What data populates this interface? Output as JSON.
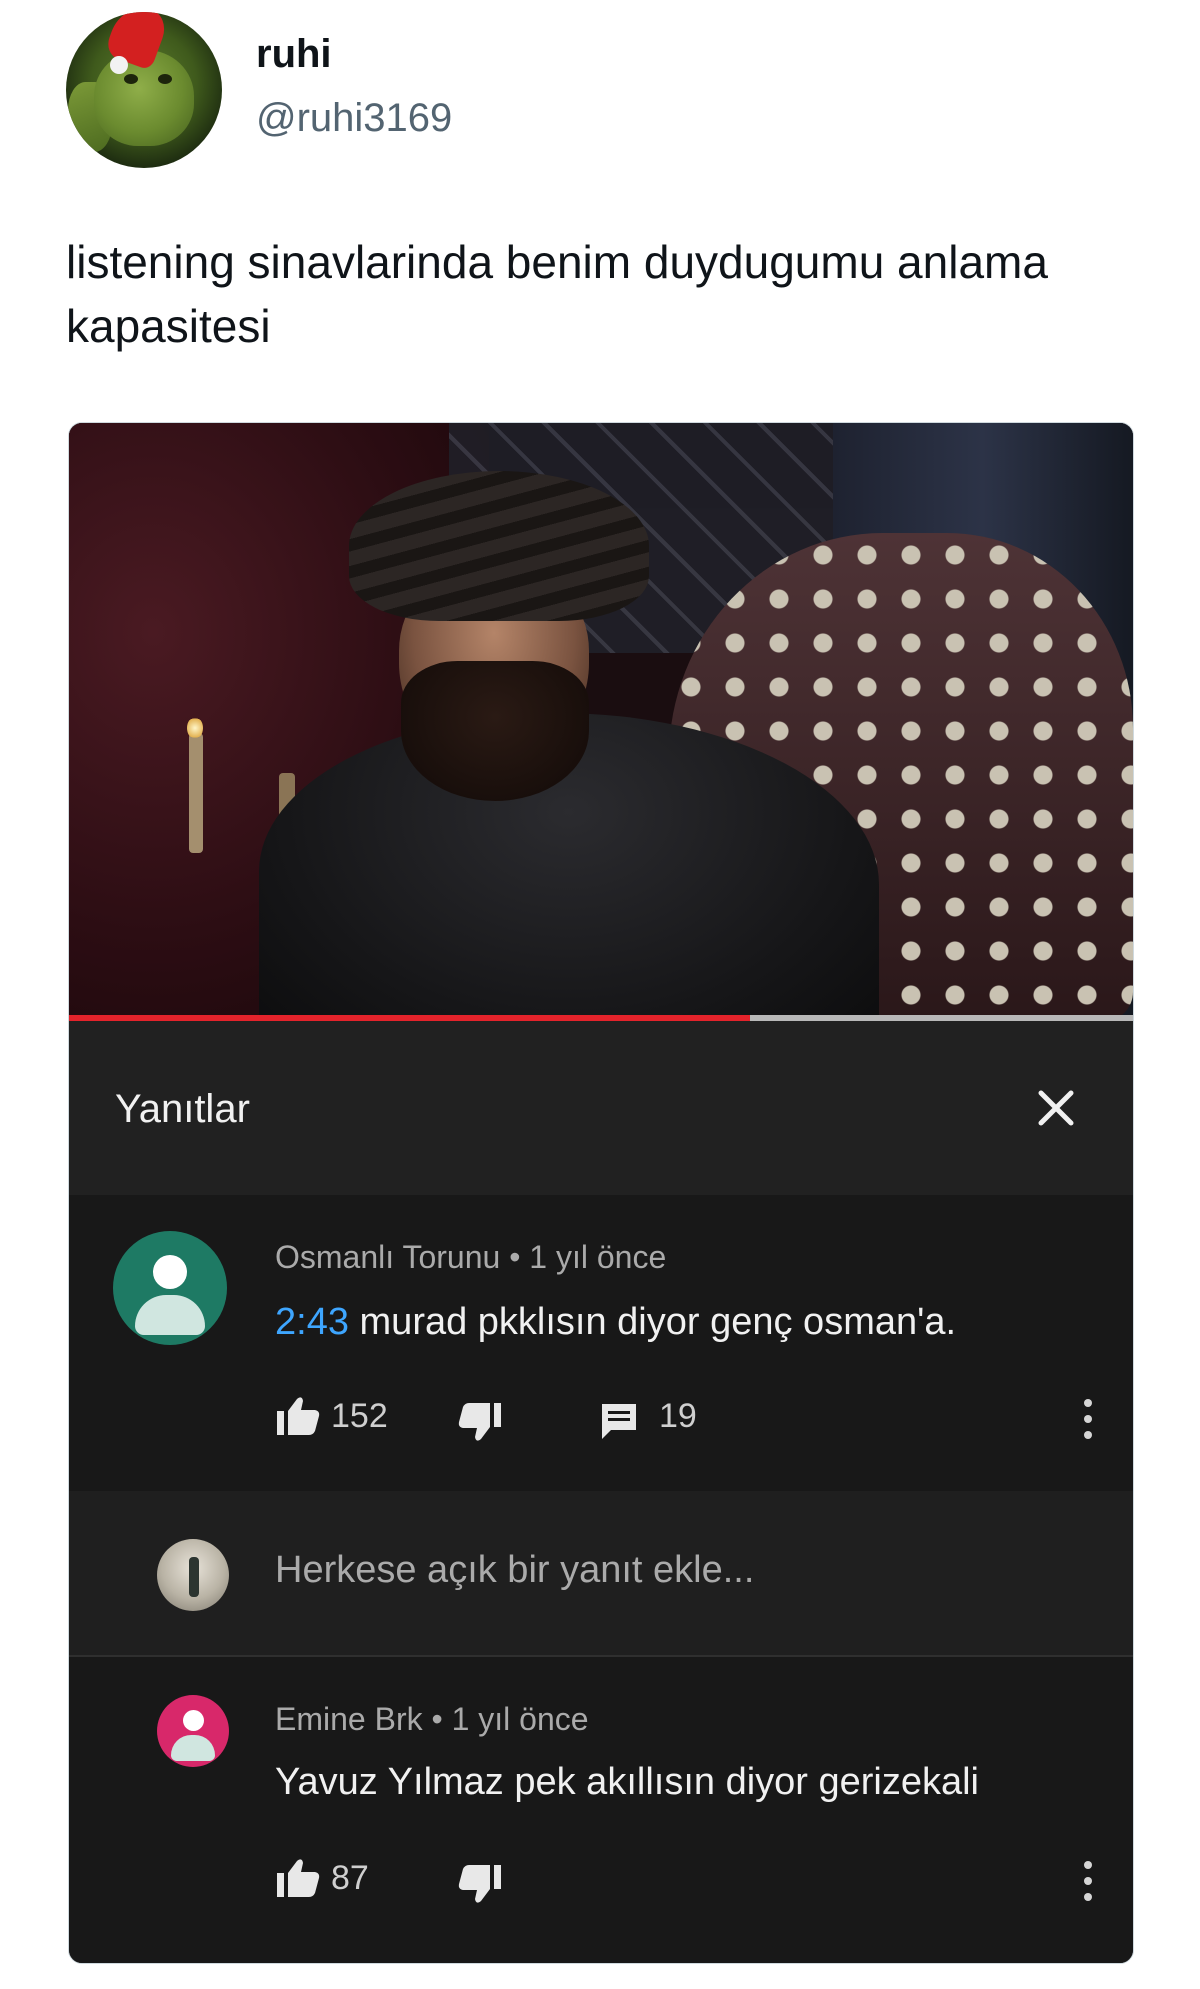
{
  "tweet": {
    "display_name": "ruhi",
    "handle": "@ruhi3169",
    "text": "listening sinavlarinda benim duydugumu anlama kapasitesi"
  },
  "video": {
    "progress_fraction": 0.64,
    "progress_color": "#e4232b"
  },
  "panel": {
    "title": "Yanıtlar",
    "close_icon": "close-icon"
  },
  "comments": [
    {
      "author": "Osmanlı Torunu",
      "age": "1 yıl önce",
      "timestamp": "2:43",
      "text": " murad pkklısın diyor genç osman'a.",
      "likes": "152",
      "replies": "19",
      "avatar_color": "#1e7a64"
    },
    {
      "author": "Emine Brk",
      "age": "1 yıl önce",
      "text": "Yavuz Yılmaz pek akıllısın diyor gerizekali",
      "likes": "87",
      "avatar_color": "#d8286a"
    }
  ],
  "reply": {
    "placeholder": "Herkese açık bir yanıt ekle..."
  },
  "colors": {
    "panel_bg": "#212121",
    "comment_bg": "#181818",
    "link_blue": "#3ea6ff"
  }
}
